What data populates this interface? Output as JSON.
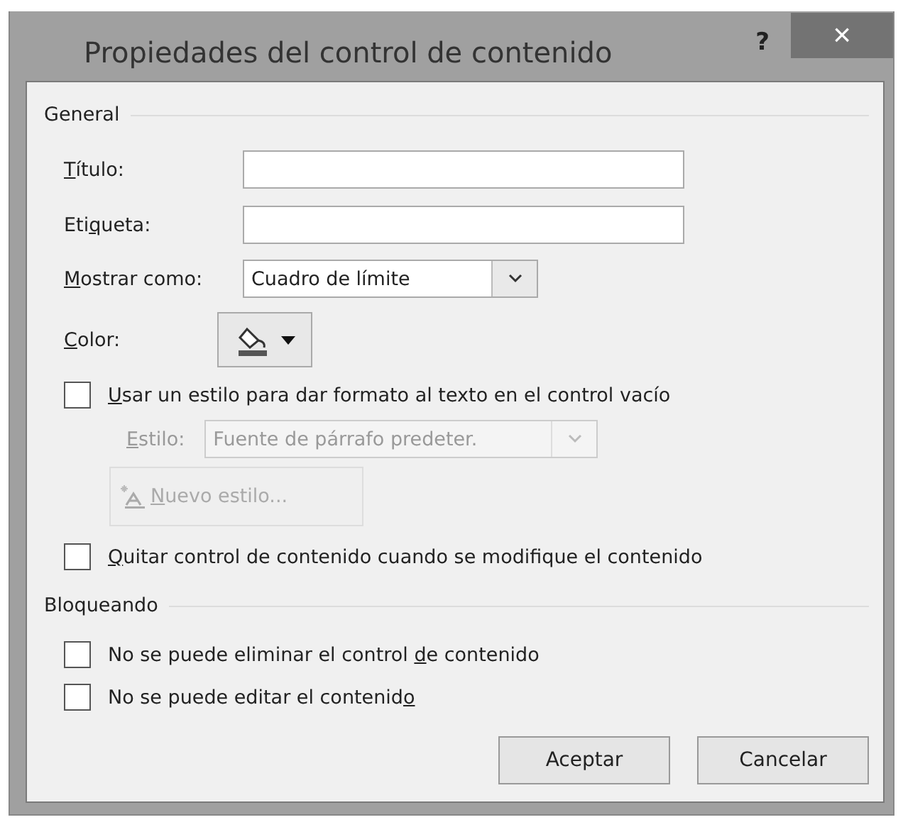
{
  "window": {
    "title": "Propiedades del control de contenido",
    "help": "?",
    "close": "×"
  },
  "sections": [
    {
      "heading": "General",
      "items": [
        {
          "kind": "text",
          "label": {
            "key": "T",
            "post": "ítulo:"
          }
        },
        {
          "kind": "text",
          "label": {
            "pre": "Eti",
            "key": "q",
            "post": "ueta:"
          }
        },
        {
          "kind": "combo",
          "label": {
            "key": "M",
            "post": "ostrar como:"
          },
          "value": "Cuadro de límite",
          "disabled": false
        },
        {
          "kind": "color",
          "label": {
            "key": "C",
            "post": "olor:"
          }
        },
        {
          "kind": "check",
          "label": {
            "key": "U",
            "post": "sar un estilo para dar formato al texto en el control vacío"
          },
          "checked": false
        },
        {
          "kind": "combo",
          "label": {
            "key": "E",
            "post": "stilo:"
          },
          "value": "Fuente de párrafo predeter.",
          "disabled": true,
          "indent": true
        },
        {
          "kind": "button",
          "label": {
            "key": "N",
            "post": "uevo estilo..."
          },
          "disabled": true
        },
        {
          "kind": "check",
          "label": {
            "key": "Q",
            "post": "uitar control de contenido cuando se modifique el contenido"
          },
          "checked": false
        }
      ]
    },
    {
      "heading": "Bloqueando",
      "items": [
        {
          "kind": "check",
          "label": {
            "pre": "No se puede eliminar el control ",
            "key": "d",
            "post": "e contenido"
          },
          "checked": false
        },
        {
          "kind": "check",
          "label": {
            "pre": "No se puede editar el contenid",
            "key": "o"
          },
          "checked": false
        }
      ]
    }
  ],
  "buttons": [
    {
      "label": "Aceptar"
    },
    {
      "label": "Cancelar"
    }
  ]
}
